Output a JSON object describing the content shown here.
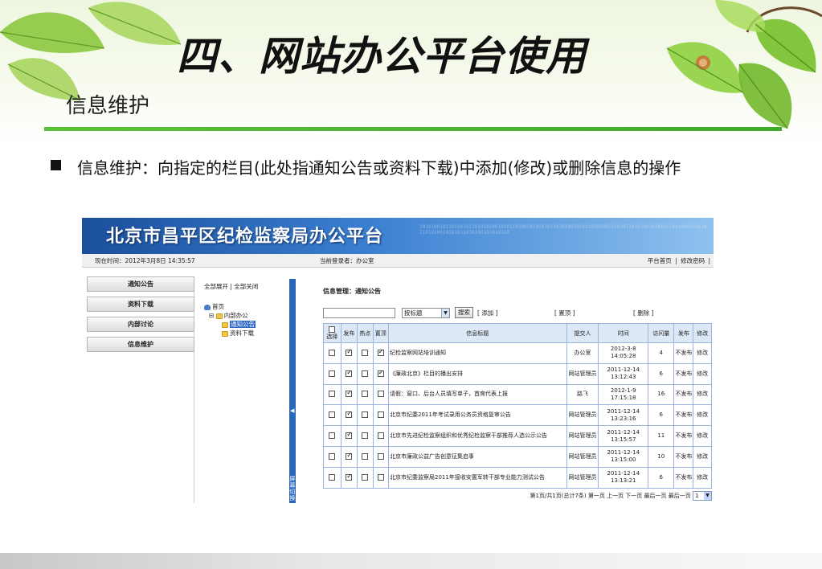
{
  "slide": {
    "title": "四、网站办公平台使用",
    "subtitle": "信息维护",
    "bullet": "信息维护：向指定的栏目(此处指通知公告或资料下载)中添加(修改)或删除信息的操作"
  },
  "colors": {
    "accent_green": "#4cb832",
    "banner_blue": "#1b4f9c",
    "table_header": "#dde8f7",
    "splitter_blue": "#2a66b8"
  },
  "app": {
    "banner_title": "北京市昌平区纪检监察局办公平台",
    "banner_binary": "1010100101101001011010101001010110100101010101101010010101101010010101011010100101010110101001010101101010010101011010100101010110",
    "infobar": {
      "time": "现在时间：2012年3月8日 14:35:57",
      "user": "当前登录者：办公室",
      "links": [
        "平台首页",
        "|",
        "修改密码",
        "|"
      ]
    },
    "menu": [
      "通知公告",
      "资料下载",
      "内部讨论",
      "信息维护"
    ],
    "tree": {
      "actions": "全部展开 | 全部关闭",
      "nodes": [
        "首页",
        "内部办公",
        "通知公告",
        "资料下载"
      ]
    },
    "splitter_label": "屏幕切换",
    "main": {
      "heading": "信息管理：通知公告",
      "search_select": "按标题",
      "search_button": "搜索",
      "add_link": "[ 添加 ]",
      "top_link": "[ 置顶 ]",
      "delete_link": "[ 删除 ]",
      "columns": [
        "选择",
        "发布",
        "热点",
        "置顶",
        "信息标题",
        "提交人",
        "时间",
        "访问量",
        "发布",
        "修改"
      ],
      "rows": [
        {
          "select": false,
          "publish": true,
          "hot": false,
          "top": true,
          "title": "纪检监察网站培训通知",
          "submitter": "办公室",
          "time": "2012-3-8 14:05:28",
          "views": "4",
          "status": "不发布",
          "edit": "修改"
        },
        {
          "select": false,
          "publish": true,
          "hot": false,
          "top": true,
          "title": "《廉政北京》栏目的播出安排",
          "submitter": "网站管理员",
          "time": "2011-12-14 13:12:43",
          "views": "6",
          "status": "不发布",
          "edit": "修改"
        },
        {
          "select": false,
          "publish": true,
          "hot": false,
          "top": false,
          "title": "请假：窗口、后台人员填写单子，首席代表上报",
          "submitter": "路飞",
          "time": "2012-1-9 17:15:18",
          "views": "16",
          "status": "不发布",
          "edit": "修改"
        },
        {
          "select": false,
          "publish": true,
          "hot": false,
          "top": false,
          "title": "北京市纪委2011年考试录用公务员资格复审公告",
          "submitter": "网站管理员",
          "time": "2011-12-14 13:23:16",
          "views": "6",
          "status": "不发布",
          "edit": "修改"
        },
        {
          "select": false,
          "publish": true,
          "hot": false,
          "top": false,
          "title": "北京市先进纪检监察组织和优秀纪检监察干部推荐人选公示公告",
          "submitter": "网站管理员",
          "time": "2011-12-14 13:15:57",
          "views": "11",
          "status": "不发布",
          "edit": "修改"
        },
        {
          "select": false,
          "publish": true,
          "hot": false,
          "top": false,
          "title": "北京市廉政公益广告创意征集启事",
          "submitter": "网站管理员",
          "time": "2011-12-14 13:15:00",
          "views": "10",
          "status": "不发布",
          "edit": "修改"
        },
        {
          "select": false,
          "publish": true,
          "hot": false,
          "top": false,
          "title": "北京市纪委监察局2011年接收安置军转干部专业能力测试公告",
          "submitter": "网站管理员",
          "time": "2011-12-14 13:13:21",
          "views": "6",
          "status": "不发布",
          "edit": "修改"
        }
      ],
      "pager": {
        "text": "第1页/共1页(总计7条) 第一页 上一页 下一页 最后一页 最后一页",
        "page_value": "1"
      }
    }
  }
}
